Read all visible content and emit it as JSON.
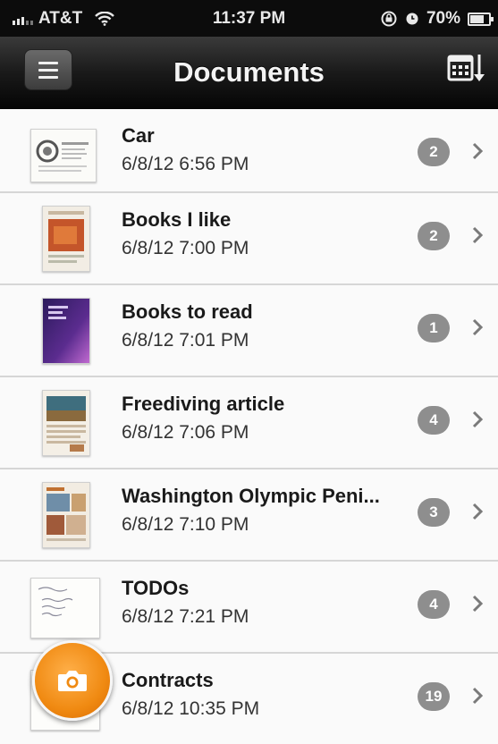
{
  "status_bar": {
    "carrier": "AT&T",
    "time": "11:37 PM",
    "battery": "70%"
  },
  "nav": {
    "title": "Documents",
    "menu_icon": "hamburger-menu-icon",
    "sort_icon": "calendar-sort-icon"
  },
  "documents": [
    {
      "title": "Car",
      "date": "6/8/12 6:56 PM",
      "count": "2"
    },
    {
      "title": "Books I like",
      "date": "6/8/12 7:00 PM",
      "count": "2"
    },
    {
      "title": "Books to read",
      "date": "6/8/12 7:01 PM",
      "count": "1"
    },
    {
      "title": "Freediving article",
      "date": "6/8/12 7:06 PM",
      "count": "4"
    },
    {
      "title": "Washington Olympic Peni...",
      "date": "6/8/12 7:10 PM",
      "count": "3"
    },
    {
      "title": "TODOs",
      "date": "6/8/12 7:21 PM",
      "count": "4"
    },
    {
      "title": "Contracts",
      "date": "6/8/12 10:35 PM",
      "count": "19"
    }
  ],
  "camera_button": {
    "icon": "camera-icon",
    "color": "#f08a12"
  },
  "colors": {
    "badge": "#8e8e8e",
    "navbar": "#1a1a1a",
    "accent": "#f08a12"
  }
}
